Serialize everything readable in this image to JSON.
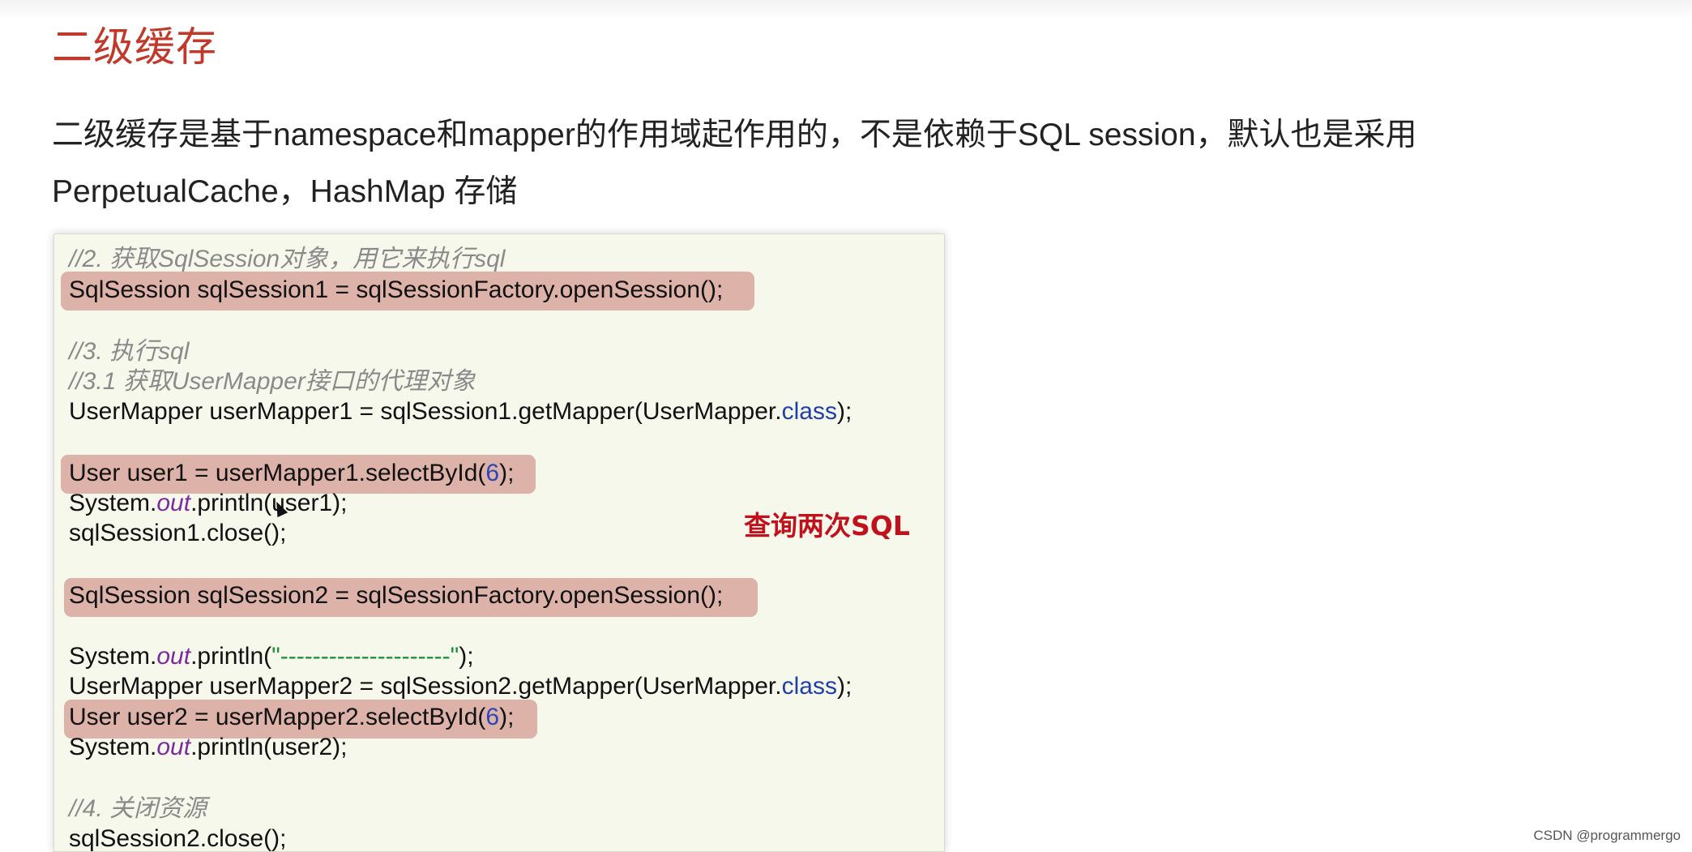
{
  "slide": {
    "title": "二级缓存",
    "description": "二级缓存是基于namespace和mapper的作用域起作用的，不是依赖于SQL session，默认也是采用 PerpetualCache，HashMap 存储"
  },
  "code": {
    "comment_get_session": "//2. 获取SqlSession对象，用它来执行sql",
    "line_open_session1": "SqlSession sqlSession1 = sqlSessionFactory.openSession();",
    "comment_exec": "//3. 执行sql",
    "comment_get_mapper": "//3.1 获取UserMapper接口的代理对象",
    "line_get_mapper1_prefix": "UserMapper userMapper1 = sqlSession1.getMapper(UserMapper.",
    "kw_class": "class",
    "line_end": ");",
    "line_select1_prefix": "User user1 = userMapper1.selectById(",
    "arg_id": "6",
    "line_print_prefix": "System.",
    "kw_out": "out",
    "line_print1_suffix": ".println(user1);",
    "line_close1": "sqlSession1.close();",
    "line_open_session2": "SqlSession sqlSession2 = sqlSessionFactory.openSession();",
    "line_print_sep_mid": ".println(",
    "str_separator": "\"---------------------\"",
    "line_get_mapper2_prefix": "UserMapper userMapper2 = sqlSession2.getMapper(UserMapper.",
    "line_select2_prefix": "User user2 = userMapper2.selectById(",
    "line_print2_suffix": ".println(user2);",
    "comment_close": "//4. 关闭资源",
    "line_close2": "sqlSession2.close();"
  },
  "annotation": {
    "note": "查询两次SQL"
  },
  "watermark": "CSDN @programmergo",
  "colors": {
    "title": "#c0392b",
    "highlight": "#d9aaa2",
    "note": "#c0121d",
    "code_bg": "#f6f8ec"
  }
}
